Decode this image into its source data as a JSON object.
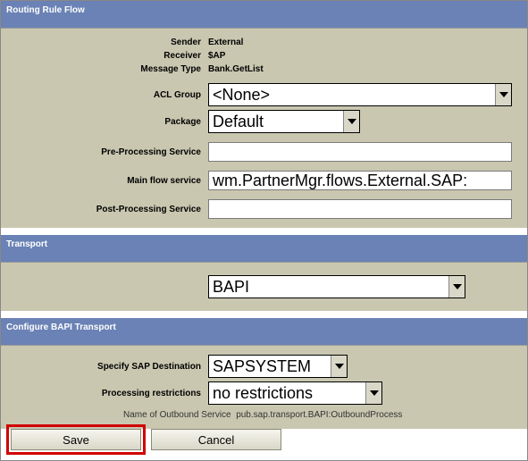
{
  "routing_rule_flow": {
    "title": "Routing Rule Flow",
    "sender_label": "Sender",
    "sender_value": "External",
    "receiver_label": "Receiver",
    "receiver_value": "$AP",
    "message_type_label": "Message Type",
    "message_type_value": "Bank.GetList",
    "acl_group_label": "ACL Group",
    "acl_group_value": "<None>",
    "package_label": "Package",
    "package_value": "Default",
    "pre_processing_label": "Pre-Processing Service",
    "pre_processing_value": "",
    "main_flow_label": "Main flow service",
    "main_flow_value": "wm.PartnerMgr.flows.External.SAP:",
    "post_processing_label": "Post-Processing Service",
    "post_processing_value": ""
  },
  "transport": {
    "title": "Transport",
    "value": "BAPI"
  },
  "configure_bapi": {
    "title": "Configure BAPI Transport",
    "sap_dest_label": "Specify SAP Destination",
    "sap_dest_value": "SAPSYSTEM",
    "restrictions_label": "Processing restrictions",
    "restrictions_value": "no restrictions",
    "outbound_label": "Name of Outbound Service",
    "outbound_value": "pub.sap.transport.BAPI:OutboundProcess"
  },
  "buttons": {
    "save": "Save",
    "cancel": "Cancel"
  }
}
